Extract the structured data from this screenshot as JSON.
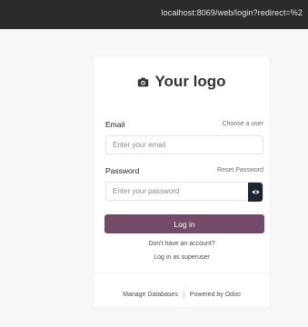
{
  "browser": {
    "url": "localhost:8069/web/login?redirect=%2"
  },
  "logo": {
    "text": "Your logo",
    "icon": "camera-icon"
  },
  "login_form": {
    "email_label": "Email",
    "choose_user_link": "Choose a user",
    "email_placeholder": "Enter your email",
    "password_label": "Password",
    "reset_password_link": "Reset Password",
    "password_placeholder": "Enter your password",
    "show_password_icon": "eye-icon",
    "login_button": "Log in",
    "signup_prompt": "Don't have an account?",
    "superuser_link": "Log in as superuser"
  },
  "footer": {
    "manage_databases": "Manage Databases",
    "powered_by": "Powered by Odoo"
  },
  "colors": {
    "primary": "#714b67",
    "eye_button": "#1f2433",
    "browser_bar": "#2b2b2e"
  }
}
